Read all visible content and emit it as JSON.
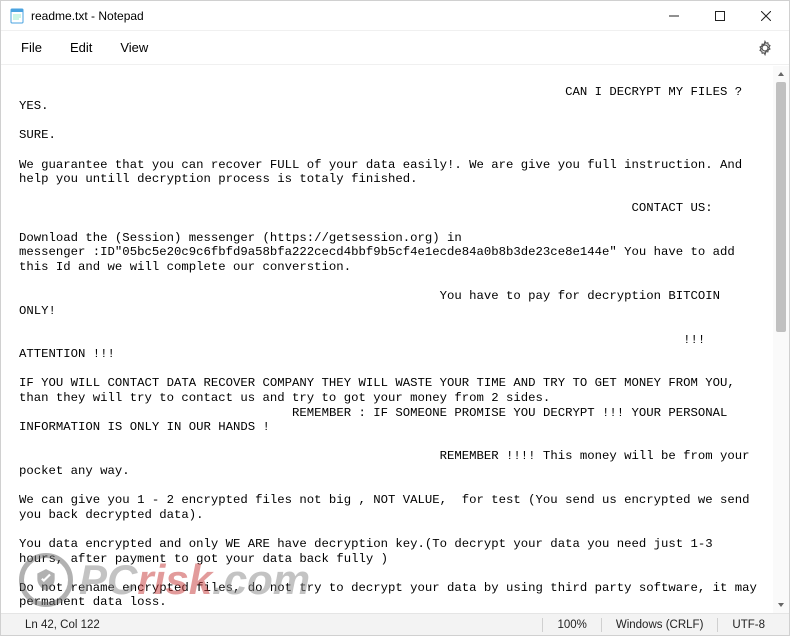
{
  "window": {
    "title": "readme.txt - Notepad"
  },
  "menubar": {
    "file": "File",
    "edit": "Edit",
    "view": "View"
  },
  "editor": {
    "content": "\n                                                                          CAN I DECRYPT MY FILES ?\nYES.\n\nSURE.\n\nWe guarantee that you can recover FULL of your data easily!. We are give you full instruction. And help you untill decryption process is totaly finished.\n\n                                                                                   CONTACT US:\n\nDownload the (Session) messenger (https://getsession.org) in\nmessenger :ID\"05bc5e20c9c6fbfd9a58bfa222cecd4bbf9b5cf4e1ecde84a0b8b3de23ce8e144e\" You have to add this Id and we will complete our converstion.\n\n                                                         You have to pay for decryption BITCOIN ONLY!\n\n                                                                                          !!! ATTENTION !!!\n\nIF YOU WILL CONTACT DATA RECOVER COMPANY THEY WILL WASTE YOUR TIME AND TRY TO GET MONEY FROM YOU, than they will try to contact us and try to got your money from 2 sides.\n                                     REMEMBER : IF SOMEONE PROMISE YOU DECRYPT !!! YOUR PERSONAL INFORMATION IS ONLY IN OUR HANDS !\n\n                                                         REMEMBER !!!! This money will be from your pocket any way.\n\nWe can give you 1 - 2 encrypted files not big , NOT VALUE,  for test (You send us encrypted we send you back decrypted data).\n\nYou data encrypted and only WE ARE have decryption key.(To decrypt your data you need just 1-3 hours, after payment to got your data back fully )\n\nDo not rename encrypted files, do not try to decrypt your data by using third party software, it may permanent data loss."
  },
  "statusbar": {
    "cursor": "Ln 42, Col 122",
    "zoom": "100%",
    "lineending": "Windows (CRLF)",
    "encoding": "UTF-8"
  },
  "watermark": {
    "prefix": "PC",
    "suffix": "risk",
    "tld": ".com"
  }
}
